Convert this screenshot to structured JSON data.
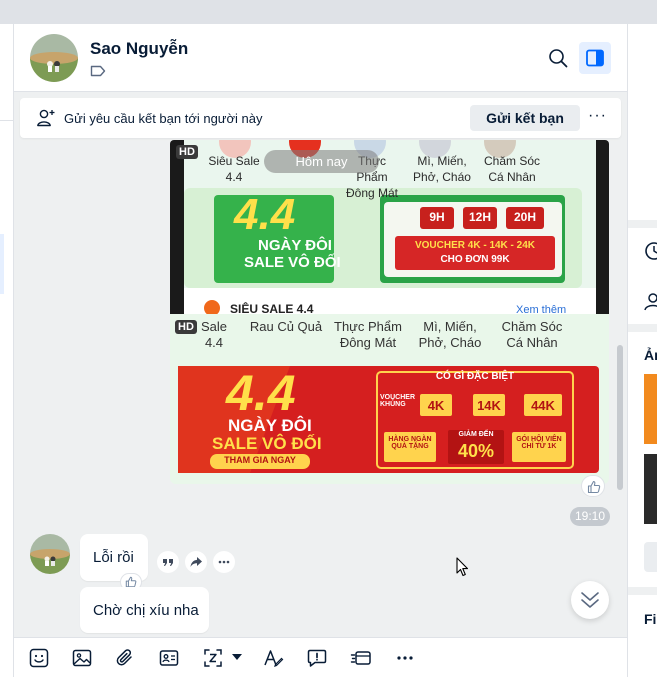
{
  "header": {
    "contact_name": "Sao Nguyễn"
  },
  "friend_request": {
    "text": "Gửi yêu cầu kết bạn tới người này",
    "button": "Gửi kết bạn",
    "more": "···"
  },
  "image_message": {
    "day_separator": "Hôm nay",
    "hd_badge": "HD",
    "top_categories": [
      "Siêu Sale 4.4",
      "Thực Phẩm Đông Mát",
      "Mì, Miến, Phở, Cháo",
      "Chăm Sóc Cá Nhân"
    ],
    "bottom_categories": [
      "Sale 4.4",
      "Rau Củ Quả",
      "Thực Phẩm Đông Mát",
      "Mì, Miến, Phở, Cháo",
      "Chăm Sóc Cá Nhân"
    ],
    "banner_top": {
      "big": "4.4",
      "line1": "NGÀY ĐÔI",
      "line2": "SALE VÔ ĐỐI",
      "boxes": [
        "9H",
        "12H",
        "20H"
      ],
      "voucher": "VOUCHER 4K - 14K - 24K",
      "order": "CHO ĐƠN 99K",
      "section": "SIÊU SALE 4.4",
      "see_more": "Xem thêm"
    },
    "banner_bottom": {
      "big": "4.4",
      "line1": "NGÀY ĐÔI",
      "line2": "SALE VÔ ĐỐI",
      "cta": "THAM GIA NGAY",
      "header": "CÓ GÌ ĐẶC BIỆT",
      "voucher_label": "VOUCHER KHỦNG",
      "vouchers": [
        "4K",
        "14K",
        "44K"
      ],
      "gifts": "HÀNG NGÀN QUÀ TẶNG",
      "discount_label": "GIẢM ĐẾN",
      "discount": "40%",
      "member": "GÓI HỘI VIÊN CHỈ TỪ 1K"
    },
    "time": "19:10"
  },
  "incoming": [
    {
      "text": "Lỗi rồi"
    },
    {
      "text": "Chờ chị xíu nha"
    }
  ],
  "right_panel": {
    "label_a": "Ản",
    "label_f": "Fi"
  },
  "colors": {
    "accent": "#0068ff",
    "banner_red": "#d51f1f",
    "banner_gold": "#ffd34d",
    "image_bg": "#e9f7ea"
  }
}
